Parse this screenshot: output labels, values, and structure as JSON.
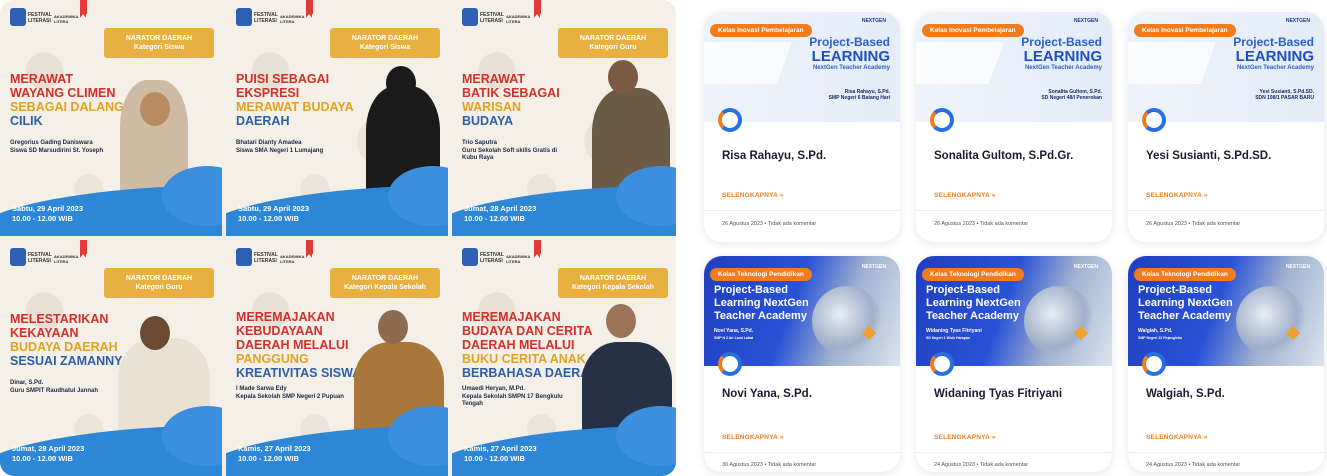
{
  "posters": [
    {
      "category_top": "NARATOR DAERAH",
      "category": "Kategori Siswa",
      "title_lines": [
        [
          "r",
          "MERAWAT"
        ],
        [
          "r",
          "WAYANG CLIMEN"
        ],
        [
          "y",
          "SEBAGAI DALANG"
        ],
        [
          "b",
          "CILIK"
        ]
      ],
      "name": "Gregorius Gading Daniswara",
      "role": "Siswa SD Marsudirini St. Yoseph",
      "date": "Sabtu, 29 April 2023",
      "time": "10.00 - 12.00 WIB"
    },
    {
      "category_top": "NARATOR DAERAH",
      "category": "Kategori Siswa",
      "title_lines": [
        [
          "r",
          "PUISI SEBAGAI"
        ],
        [
          "r",
          "EKSPRESI"
        ],
        [
          "y",
          "MERAWAT BUDAYA"
        ],
        [
          "b",
          "DAERAH"
        ]
      ],
      "name": "Bhatari Dianty Amadea",
      "role": "Siswa SMA Negeri 1 Lumajang",
      "date": "Sabtu, 29 April 2023",
      "time": "10.00 - 12.00 WIB"
    },
    {
      "category_top": "NARATOR DAERAH",
      "category": "Kategori Guru",
      "title_lines": [
        [
          "r",
          "MERAWAT"
        ],
        [
          "r",
          "BATIK SEBAGAI"
        ],
        [
          "y",
          "WARISAN"
        ],
        [
          "b",
          "BUDAYA"
        ]
      ],
      "name": "Trio Saputra",
      "role": "Guru Sekolah Soft skills Gratis di Kubu Raya",
      "date": "Jumat, 28 April 2023",
      "time": "10.00 - 12.00 WIB"
    },
    {
      "category_top": "NARATOR DAERAH",
      "category": "Kategori Guru",
      "title_lines": [
        [
          "r",
          "MELESTARIKAN"
        ],
        [
          "r",
          "KEKAYAAN"
        ],
        [
          "y",
          "BUDAYA DAERAH"
        ],
        [
          "b",
          "SESUAI ZAMANNYA"
        ]
      ],
      "name": "Dinar, S.Pd.",
      "role": "Guru SMPIT Raudhatul Jannah",
      "date": "Jumat, 28 April 2023",
      "time": "10.00 - 12.00 WIB"
    },
    {
      "category_top": "NARATOR DAERAH",
      "category": "Kategori Kepala Sekolah",
      "title_lines": [
        [
          "r",
          "MEREMAJAKAN"
        ],
        [
          "r",
          "KEBUDAYAAN"
        ],
        [
          "r",
          "DAERAH MELALUI"
        ],
        [
          "y",
          "PANGGUNG"
        ],
        [
          "b",
          "KREATIVITAS SISWA"
        ]
      ],
      "name": "I Made Sarwa Edy",
      "role": "Kepala Sekolah SMP Negeri 2 Pupuan",
      "date": "Kamis, 27 April 2023",
      "time": "10.00 - 12.00 WIB"
    },
    {
      "category_top": "NARATOR DAERAH",
      "category": "Kategori Kepala Sekolah",
      "title_lines": [
        [
          "r",
          "MEREMAJAKAN"
        ],
        [
          "r",
          "BUDAYA DAN CERITA"
        ],
        [
          "r",
          "DAERAH MELALUI"
        ],
        [
          "y",
          "BUKU CERITA ANAK"
        ],
        [
          "b",
          "BERBAHASA DAERAH"
        ]
      ],
      "name": "Umaedi Heryan, M.Pd.",
      "role": "Kepala Sekolah SMPN 17 Bengkulu Tengah",
      "date": "Kamis, 27 April 2023",
      "time": "10.00 - 12.00 WIB"
    }
  ],
  "logo": {
    "text": "FESTIVAL LITERASI",
    "academy": "AKADEMIKA LITERA"
  },
  "cards": [
    {
      "style": "light",
      "tag": "Kelas Inovasi Pembelajaran",
      "brand": "NEXTGEN",
      "h1": "Project-Based",
      "h2": "LEARNING",
      "h3": "NextGen Teacher Academy",
      "who1": "Risa Rahayu, S.Pd.",
      "who2": "SMP Negeri 6 Batang Hari",
      "name": "Risa Rahayu, S.Pd.",
      "more": "SELENGKAPNYA »",
      "meta": "26 Agustus 2023  •  Tidak ada komentar"
    },
    {
      "style": "light",
      "tag": "Kelas Inovasi Pembelajaran",
      "brand": "NEXTGEN",
      "h1": "Project-Based",
      "h2": "LEARNING",
      "h3": "NextGen Teacher Academy",
      "who1": "Sonalita Gultom, S.Pd.",
      "who2": "SD Negeri 48/I Penerokan",
      "name": "Sonalita Gultom, S.Pd.Gr.",
      "more": "SELENGKAPNYA »",
      "meta": "26 Agustus 2023  •  Tidak ada komentar"
    },
    {
      "style": "light",
      "tag": "Kelas Inovasi Pembelajaran",
      "brand": "NEXTGEN",
      "h1": "Project-Based",
      "h2": "LEARNING",
      "h3": "NextGen Teacher Academy",
      "who1": "Yesi Susianti, S.Pd.SD.",
      "who2": "SDN 198/1 PASAR BARU",
      "name": "Yesi Susianti, S.Pd.SD.",
      "more": "SELENGKAPNYA »",
      "meta": "26 Agustus 2023  •  Tidak ada komentar"
    },
    {
      "style": "dark",
      "tag": "Kelas Teknologi Pendidikan",
      "brand": "NEXTGEN",
      "h1": "Project-Based Learning NextGen Teacher Academy",
      "who1": "Novi Yana, S.Pd.",
      "who2": "SMP N 2 Air Lami Lahat",
      "name": "Novi Yana, S.Pd.",
      "more": "SELENGKAPNYA »",
      "meta": "30 Agustus 2023  •  Tidak ada komentar"
    },
    {
      "style": "dark",
      "tag": "Kelas Teknologi Pendidikan",
      "brand": "NEXTGEN",
      "h1": "Project-Based Learning NextGen Teacher Academy",
      "who1": "Widaning Tyas Fitriyani",
      "who2": "SD Negeri 1 Wolo Harapan",
      "name": "Widaning Tyas Fitriyani",
      "more": "SELENGKAPNYA »",
      "meta": "24 Agustus 2023  •  Tidak ada komentar"
    },
    {
      "style": "dark",
      "tag": "Kelas Teknologi Pendidikan",
      "brand": "NEXTGEN",
      "h1": "Project-Based Learning NextGen Teacher Academy",
      "who1": "Walgiah, S.Pd.",
      "who2": "SMP Negeri 23 Rejanglebo",
      "name": "Walgiah, S.Pd.",
      "more": "SELENGKAPNYA »",
      "meta": "24 Agustus 2023  •  Tidak ada komentar"
    }
  ]
}
